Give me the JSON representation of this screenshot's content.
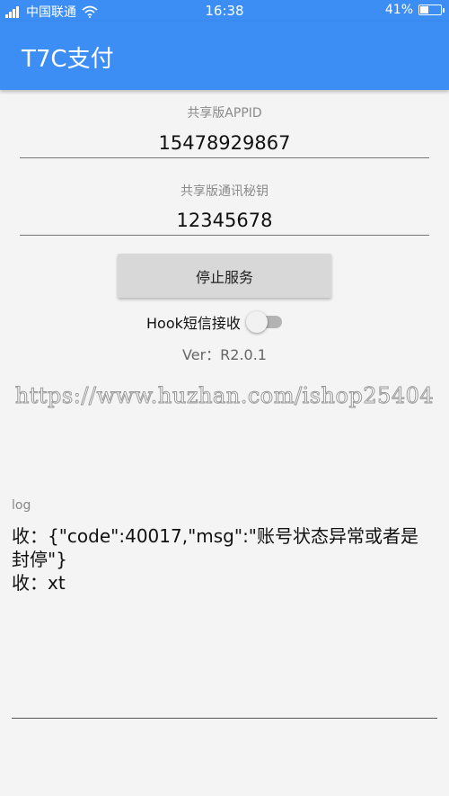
{
  "status_bar": {
    "carrier": "中国联通",
    "time": "16:38",
    "battery": "41%",
    "battery_level": 0.41,
    "signal_icon": "signal-icon",
    "wifi_icon": "wifi-icon",
    "battery_icon": "battery-icon"
  },
  "app_bar": {
    "title": "T7C支付",
    "color": "#3c8ef5"
  },
  "form": {
    "appid_label": "共享版APPID",
    "appid_value": "15478929867",
    "secret_label": "共享版通讯秘钥",
    "secret_value": "12345678"
  },
  "stop_button": {
    "label": "停止服务"
  },
  "hook_sms": {
    "label": "Hook短信接收",
    "enabled": false
  },
  "version": "Ver：R2.0.1",
  "watermark": "https://www.huzhan.com/ishop25404",
  "log": {
    "label": "log",
    "lines": [
      "收：{\"code\":40017,\"msg\":\"账号状态异常或者是封停\"}",
      "收：xt"
    ]
  }
}
